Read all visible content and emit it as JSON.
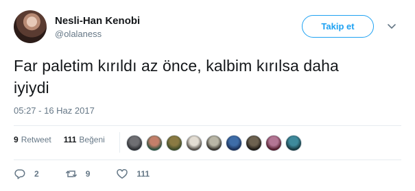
{
  "author": {
    "display_name": "Nesli-Han Kenobi",
    "screen_name": "@olalaness"
  },
  "follow_button_label": "Takip et",
  "tweet": {
    "text_line1": "Far paletim kırıldı az önce, kalbim kırılsa daha",
    "text_line2": "iyiydi",
    "timestamp": "05:27 - 16 Haz 2017"
  },
  "stats": {
    "retweets_count": "9",
    "retweets_label": "Retweet",
    "likes_count": "111",
    "likes_label": "Beğeni"
  },
  "liker_avatars": [
    {
      "colors": [
        "#6f6f73",
        "#2d2f33"
      ]
    },
    {
      "colors": [
        "#c37f6a",
        "#2b4f3d"
      ]
    },
    {
      "colors": [
        "#8a7a43",
        "#3c4a2a"
      ]
    },
    {
      "colors": [
        "#e3ddd3",
        "#4f4a44"
      ]
    },
    {
      "colors": [
        "#b9b6a6",
        "#33302a"
      ]
    },
    {
      "colors": [
        "#3e6da8",
        "#1b2f55"
      ]
    },
    {
      "colors": [
        "#6d6250",
        "#1d1a16"
      ]
    },
    {
      "colors": [
        "#b37694",
        "#4d1b2a"
      ]
    },
    {
      "colors": [
        "#3e8a9c",
        "#17373f"
      ]
    }
  ],
  "actions": {
    "reply_count": "2",
    "retweet_count": "9",
    "like_count": "111"
  },
  "colors": {
    "accent": "#1da1f2",
    "muted": "#657786",
    "text": "#14171a",
    "divider": "#e6ecf0"
  },
  "icons": [
    "reply-icon",
    "retweet-icon",
    "heart-icon",
    "chevron-down-icon"
  ]
}
